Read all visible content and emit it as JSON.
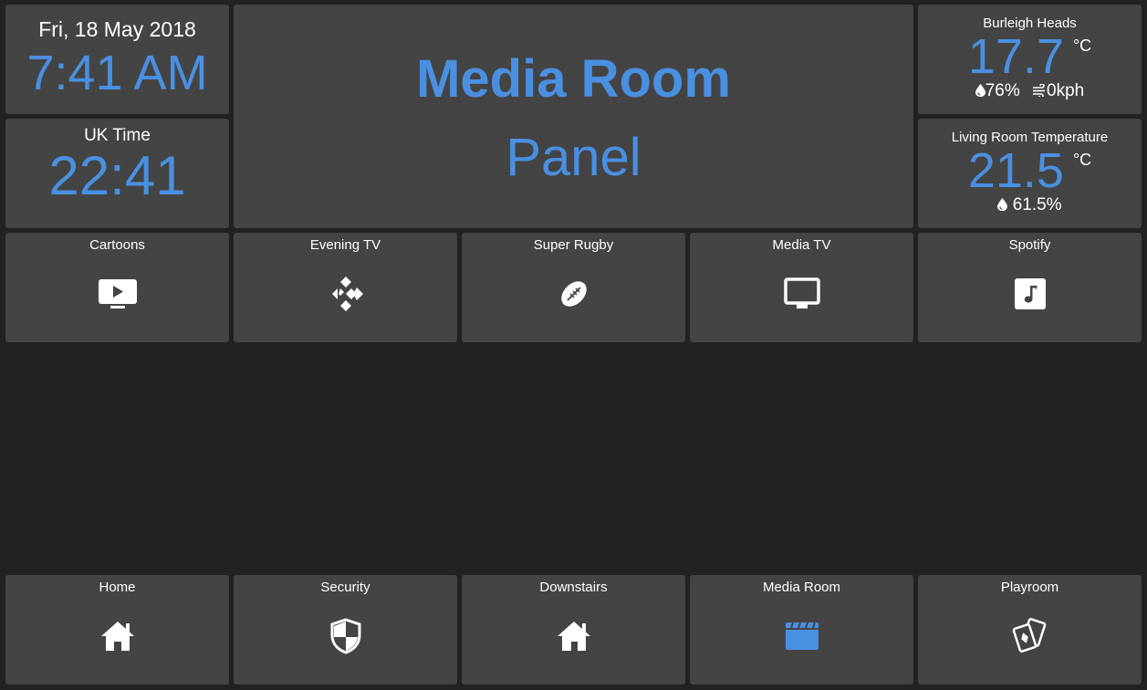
{
  "clock": {
    "date": "Fri, 18 May 2018",
    "time": "7:41 AM"
  },
  "uk_clock": {
    "title": "UK Time",
    "time": "22:41"
  },
  "title_panel": {
    "line1": "Media Room",
    "line2": "Panel"
  },
  "weather": {
    "title": "Burleigh Heads",
    "temperature": "17.7",
    "unit": "°C",
    "humidity": "76%",
    "wind": "0kph"
  },
  "room_temp": {
    "title": "Living Room Temperature",
    "temperature": "21.5",
    "unit": "°C",
    "humidity": "61.5%"
  },
  "scenes": [
    {
      "label": "Cartoons",
      "icon": "tv-play-icon"
    },
    {
      "label": "Evening TV",
      "icon": "kodi-icon"
    },
    {
      "label": "Super Rugby",
      "icon": "rugby-ball-icon"
    },
    {
      "label": "Media TV",
      "icon": "monitor-icon"
    },
    {
      "label": "Spotify",
      "icon": "music-note-icon"
    }
  ],
  "nav": [
    {
      "label": "Home",
      "icon": "home-icon"
    },
    {
      "label": "Security",
      "icon": "shield-icon"
    },
    {
      "label": "Downstairs",
      "icon": "home-icon"
    },
    {
      "label": "Media Room",
      "icon": "clapperboard-icon"
    },
    {
      "label": "Playroom",
      "icon": "playing-cards-icon"
    }
  ],
  "colors": {
    "background": "#222222",
    "tile": "#444444",
    "accent": "#4a90e2",
    "text": "#ffffff"
  }
}
